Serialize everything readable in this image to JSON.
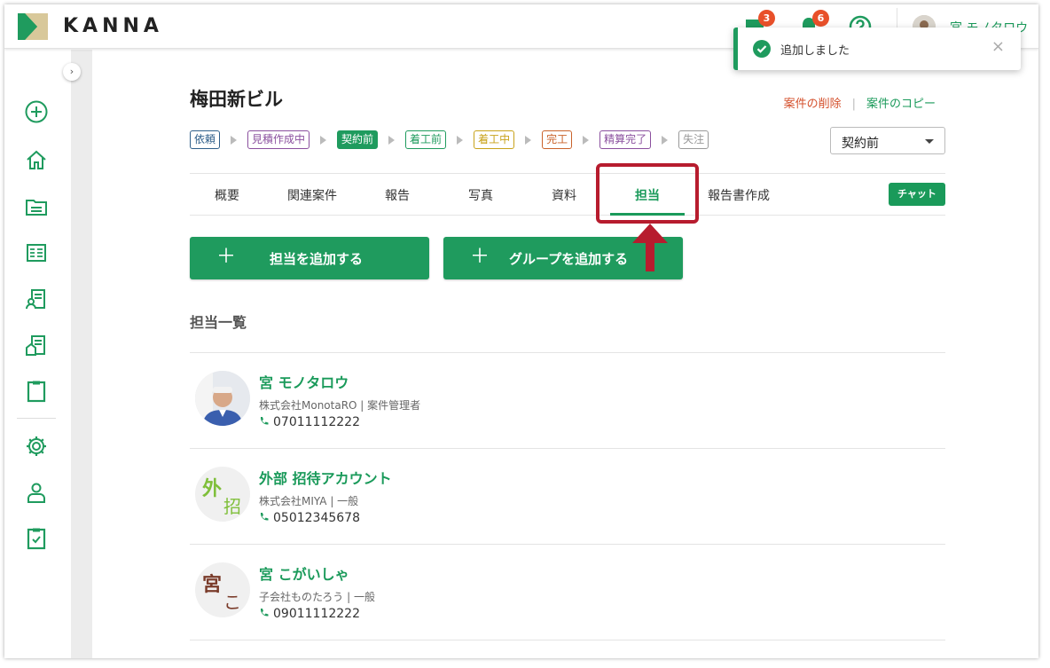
{
  "app": {
    "logo_text": "KANNA"
  },
  "header": {
    "chat_badge": "3",
    "notification_badge": "6",
    "user_name": "宮 モノタロウ"
  },
  "toast": {
    "message": "追加しました",
    "close_label": "×"
  },
  "project": {
    "title": "梅田新ビル",
    "delete_label": "案件の削除",
    "separator": "|",
    "copy_label": "案件のコピー"
  },
  "steps": [
    {
      "label": "依頼",
      "color": "#2f5f8a",
      "active": false
    },
    {
      "label": "見積作成中",
      "color": "#8a4f9e",
      "active": false
    },
    {
      "label": "契約前",
      "color": "#1f9b5e",
      "active": true
    },
    {
      "label": "着工前",
      "color": "#1f9b5e",
      "active": false
    },
    {
      "label": "着工中",
      "color": "#c8a21a",
      "active": false
    },
    {
      "label": "完工",
      "color": "#c9622a",
      "active": false
    },
    {
      "label": "精算完了",
      "color": "#8a4f9e",
      "active": false
    },
    {
      "label": "失注",
      "color": "#999999",
      "active": false
    }
  ],
  "status_select": {
    "value": "契約前"
  },
  "tabs": [
    {
      "label": "概要"
    },
    {
      "label": "関連案件"
    },
    {
      "label": "報告"
    },
    {
      "label": "写真"
    },
    {
      "label": "資料"
    },
    {
      "label": "担当"
    },
    {
      "label": "報告書作成"
    }
  ],
  "chat_button": "チャット",
  "actions": {
    "add_member": "担当を追加する",
    "add_group": "グループを追加する",
    "plus": "＋"
  },
  "members_section": {
    "title": "担当一覧"
  },
  "members": [
    {
      "name": "宮 モノタロウ",
      "org": "株式会社MonotaRO | 案件管理者",
      "phone": "07011112222",
      "avatar_char1": "",
      "avatar_char2": "",
      "avatar_color": "#7fbf3a"
    },
    {
      "name": "外部 招待アカウント",
      "org": "株式会社MIYA | 一般",
      "phone": "05012345678",
      "avatar_char1": "外",
      "avatar_char2": "招",
      "avatar_color": "#7fbf3a"
    },
    {
      "name": "宮 こがいしゃ",
      "org": "子会社ものたろう | 一般",
      "phone": "09011112222",
      "avatar_char1": "宮",
      "avatar_char2": "こ",
      "avatar_color": "#7a3b2a"
    }
  ],
  "colors": {
    "brand_green": "#1f9b5e",
    "danger": "#d4502c",
    "highlight": "#b71c2e"
  }
}
